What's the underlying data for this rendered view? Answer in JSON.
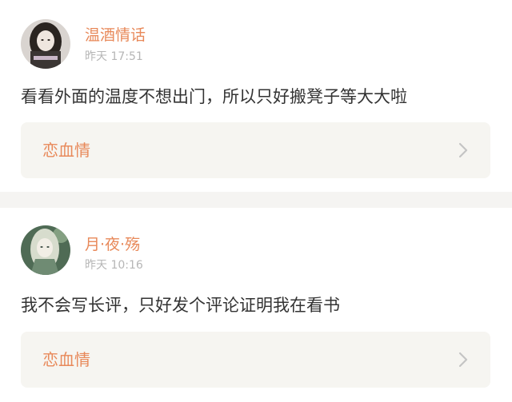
{
  "posts": [
    {
      "username": "温酒情话",
      "timestamp": "昨天 17:51",
      "content": "看看外面的温度不想出门，所以只好搬凳子等大大啦",
      "book_title": "恋血情",
      "avatar_icon": "avatar-girl-dark-hair-icon"
    },
    {
      "username": "月·夜·殇",
      "timestamp": "昨天 10:16",
      "content": "我不会写长评，只好发个评论证明我在看书",
      "book_title": "恋血情",
      "avatar_icon": "avatar-anime-character-icon"
    }
  ],
  "colors": {
    "accent": "#e8895a",
    "timestamp": "#b6b6b6",
    "text": "#333333",
    "card_bg": "#f6f5f1",
    "separator": "#f5f4f2"
  }
}
